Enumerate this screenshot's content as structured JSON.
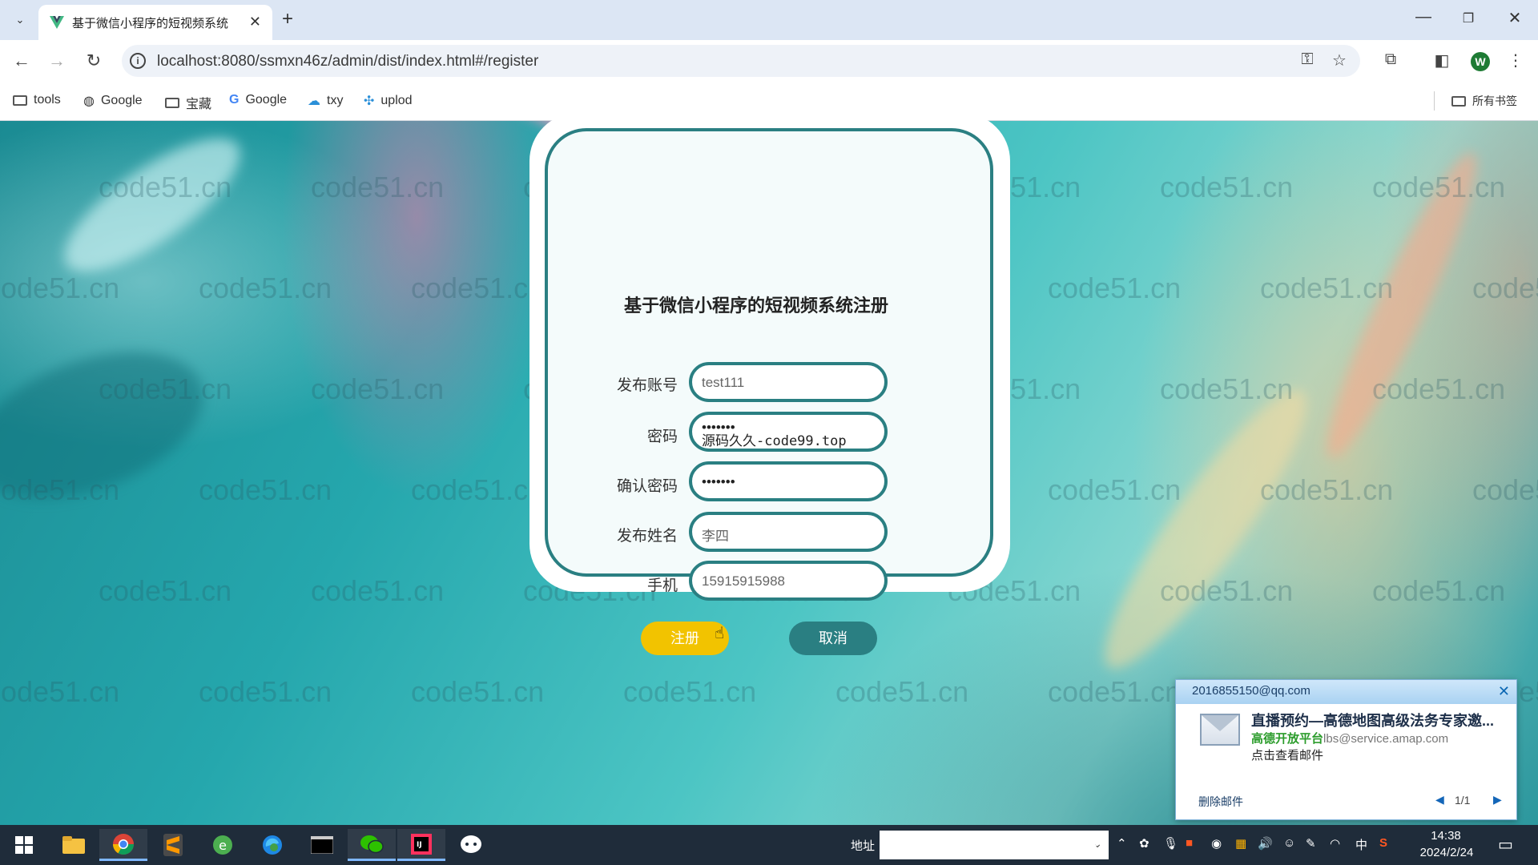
{
  "browser": {
    "tab_title": "基于微信小程序的短视频系统",
    "url": "localhost:8080/ssmxn46z/admin/dist/index.html#/register",
    "profile_initial": "W",
    "bookmarks": [
      {
        "label": "tools",
        "icon": "folder-icon"
      },
      {
        "label": "Google",
        "icon": "globe-icon"
      },
      {
        "label": "宝藏",
        "icon": "folder-icon"
      },
      {
        "label": "Google",
        "icon": "google-icon"
      },
      {
        "label": "txy",
        "icon": "cloud-icon"
      },
      {
        "label": "uplod",
        "icon": "link-icon"
      }
    ],
    "all_bookmarks_label": "所有书签"
  },
  "watermark_text": "code51.cn",
  "register_form": {
    "title": "基于微信小程序的短视频系统注册",
    "fields": [
      {
        "label": "发布账号",
        "value": "test111"
      },
      {
        "label": "密码",
        "value": "•••••••",
        "overlay_text": "源码久久-code99.top"
      },
      {
        "label": "确认密码",
        "value": "•••••••"
      },
      {
        "label": "发布姓名",
        "value": "李四"
      },
      {
        "label": "手机",
        "value": "15915915988"
      }
    ],
    "register_button": "注册",
    "cancel_button": "取消"
  },
  "mail_popup": {
    "from": "2016855150@qq.com",
    "subject": "直播预约—高德地图高级法务专家邀...",
    "sender_name": "高德开放平台",
    "sender_email": "lbs@service.amap.com",
    "view_mail": "点击查看邮件",
    "delete_mail": "删除邮件",
    "pagination": "1/1"
  },
  "taskbar": {
    "address_label": "地址",
    "ime_label": "中",
    "time": "14:38",
    "date": "2024/2/24"
  },
  "colors": {
    "accent_teal": "#2a7f82",
    "register_yellow": "#f2c300",
    "tab_bar": "#dce6f4"
  }
}
